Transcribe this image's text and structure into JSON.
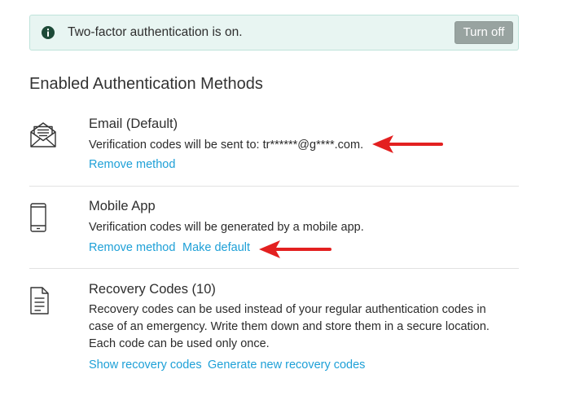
{
  "banner": {
    "icon": "info-icon",
    "message": "Two-factor authentication is on.",
    "turn_off_label": "Turn off"
  },
  "section": {
    "title": "Enabled Authentication Methods"
  },
  "methods": [
    {
      "icon": "envelope-icon",
      "title": "Email (Default)",
      "description": "Verification codes will be sent to: tr******@g****.com.",
      "actions": [
        "Remove method"
      ]
    },
    {
      "icon": "mobile-phone-icon",
      "title": "Mobile App",
      "description": "Verification codes will be generated by a mobile app.",
      "actions": [
        "Remove method",
        "Make default"
      ]
    },
    {
      "icon": "document-icon",
      "title": "Recovery Codes (10)",
      "description": "Recovery codes can be used instead of your regular authentication codes in case of an emergency. Write them down and store them in a secure location. Each code can be used only once.",
      "actions": [
        "Show recovery codes",
        "Generate new recovery codes"
      ]
    }
  ],
  "colors": {
    "banner_bg": "#e8f5f2",
    "banner_border": "#bfe3db",
    "button_bg": "#98a3a0",
    "link": "#1ea0d7",
    "annotation": "#e32020"
  }
}
